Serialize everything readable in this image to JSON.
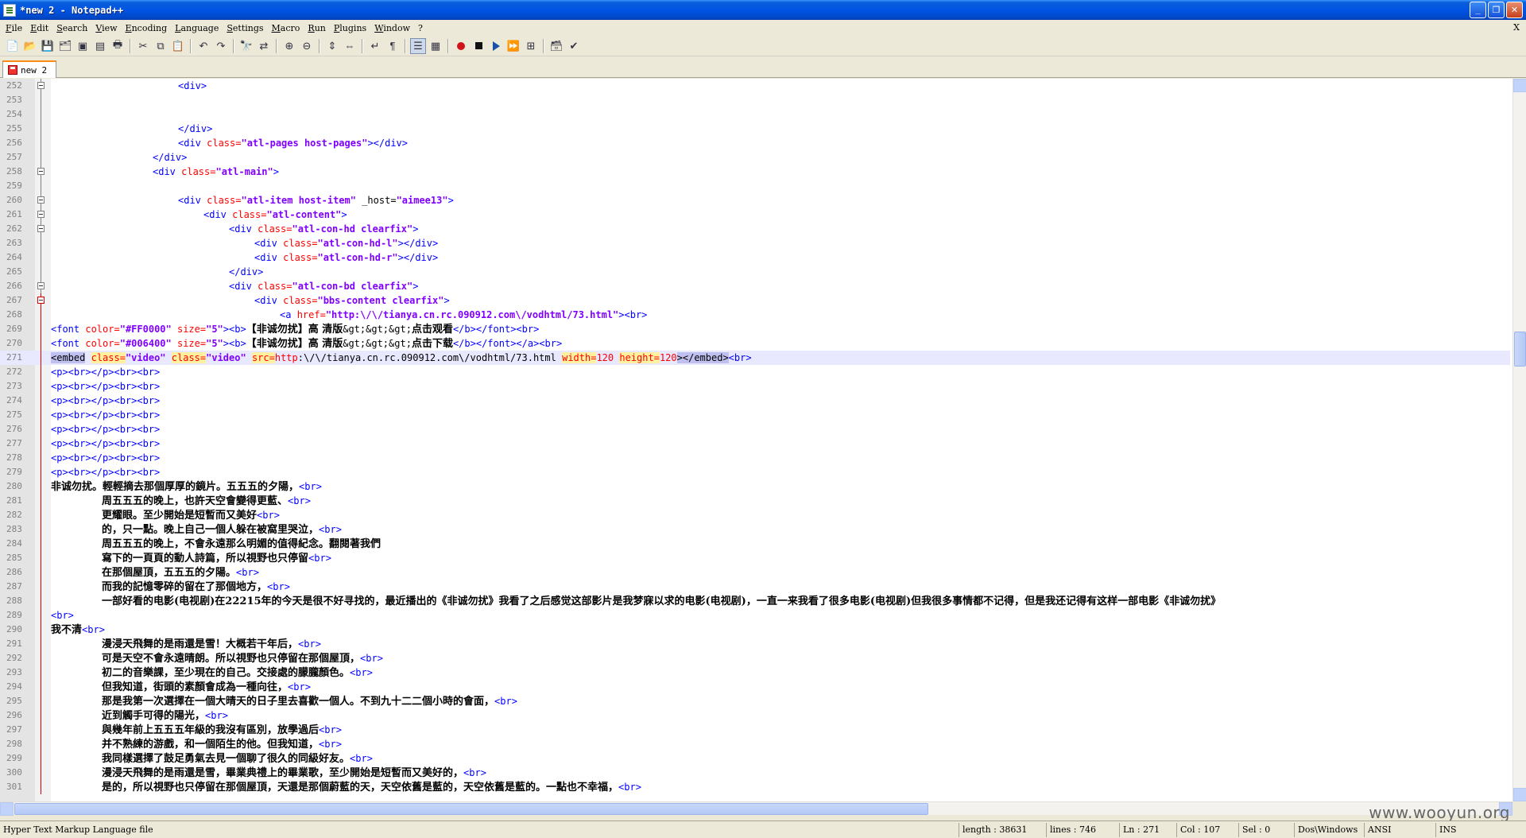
{
  "window": {
    "title": "*new  2 - Notepad++",
    "minimize": "_",
    "maximize": "❐",
    "close": "✕"
  },
  "menu": {
    "items": [
      "File",
      "Edit",
      "Search",
      "View",
      "Encoding",
      "Language",
      "Settings",
      "Macro",
      "Run",
      "Plugins",
      "Window",
      "?"
    ],
    "doc_close": "X"
  },
  "tabs": [
    {
      "label": "new  2"
    }
  ],
  "editor": {
    "lines": [
      {
        "n": "252",
        "indent": 10,
        "segs": [
          [
            "tag",
            "<div>"
          ]
        ]
      },
      {
        "n": "253",
        "indent": 0,
        "segs": []
      },
      {
        "n": "254",
        "indent": 0,
        "segs": []
      },
      {
        "n": "255",
        "indent": 10,
        "segs": [
          [
            "tag",
            "</div>"
          ]
        ]
      },
      {
        "n": "256",
        "indent": 10,
        "segs": [
          [
            "tag",
            "<div "
          ],
          [
            "attr",
            "class="
          ],
          [
            "val",
            "\"atl-pages host-pages\""
          ],
          [
            "tag",
            "></div>"
          ]
        ]
      },
      {
        "n": "257",
        "indent": 8,
        "segs": [
          [
            "tag",
            "</div>"
          ]
        ]
      },
      {
        "n": "258",
        "indent": 8,
        "segs": [
          [
            "tag",
            "<div "
          ],
          [
            "attr",
            "class="
          ],
          [
            "val",
            "\"atl-main\""
          ],
          [
            "tag",
            ">"
          ]
        ]
      },
      {
        "n": "259",
        "indent": 0,
        "segs": []
      },
      {
        "n": "260",
        "indent": 10,
        "segs": [
          [
            "tag",
            "<div "
          ],
          [
            "attr",
            "class="
          ],
          [
            "val",
            "\"atl-item host-item\""
          ],
          [
            "txt",
            " _host="
          ],
          [
            "val",
            "\"aimee13\""
          ],
          [
            "tag",
            ">"
          ]
        ]
      },
      {
        "n": "261",
        "indent": 12,
        "segs": [
          [
            "tag",
            "<div "
          ],
          [
            "attr",
            "class="
          ],
          [
            "val",
            "\"atl-content\""
          ],
          [
            "tag",
            ">"
          ]
        ]
      },
      {
        "n": "262",
        "indent": 14,
        "segs": [
          [
            "tag",
            "<div "
          ],
          [
            "attr",
            "class="
          ],
          [
            "val",
            "\"atl-con-hd clearfix\""
          ],
          [
            "tag",
            ">"
          ]
        ]
      },
      {
        "n": "263",
        "indent": 16,
        "segs": [
          [
            "tag",
            "<div "
          ],
          [
            "attr",
            "class="
          ],
          [
            "val",
            "\"atl-con-hd-l\""
          ],
          [
            "tag",
            "></div>"
          ]
        ]
      },
      {
        "n": "264",
        "indent": 16,
        "segs": [
          [
            "tag",
            "<div "
          ],
          [
            "attr",
            "class="
          ],
          [
            "val",
            "\"atl-con-hd-r\""
          ],
          [
            "tag",
            "></div>"
          ]
        ]
      },
      {
        "n": "265",
        "indent": 14,
        "segs": [
          [
            "tag",
            "</div>"
          ]
        ]
      },
      {
        "n": "266",
        "indent": 14,
        "segs": [
          [
            "tag",
            "<div "
          ],
          [
            "attr",
            "class="
          ],
          [
            "val",
            "\"atl-con-bd clearfix\""
          ],
          [
            "tag",
            ">"
          ]
        ]
      },
      {
        "n": "267",
        "indent": 16,
        "segs": [
          [
            "tag",
            "<div "
          ],
          [
            "attr",
            "class="
          ],
          [
            "val",
            "\"bbs-content clearfix\""
          ],
          [
            "tag",
            ">"
          ]
        ]
      },
      {
        "n": "268",
        "indent": 18,
        "segs": [
          [
            "tag",
            "<a "
          ],
          [
            "attr",
            "href="
          ],
          [
            "val",
            "\"http:\\/\\/tianya.cn.rc.090912.com\\/vodhtml/73.html\""
          ],
          [
            "tag",
            "><br>"
          ]
        ]
      },
      {
        "n": "269",
        "indent": 0,
        "segs": [
          [
            "tag",
            "<font "
          ],
          [
            "attr",
            "color="
          ],
          [
            "val",
            "\"#FF0000\""
          ],
          [
            "attr",
            " size="
          ],
          [
            "val",
            "\"5\""
          ],
          [
            "tag",
            "><b>"
          ],
          [
            "cjk",
            "【非诚勿扰】高 清版"
          ],
          [
            "txt",
            "&gt;&gt;&gt;"
          ],
          [
            "cjk",
            "点击观看"
          ],
          [
            "tag",
            "</b></font><br>"
          ]
        ]
      },
      {
        "n": "270",
        "indent": 0,
        "segs": [
          [
            "tag",
            "<font "
          ],
          [
            "attr",
            "color="
          ],
          [
            "val",
            "\"#006400\""
          ],
          [
            "attr",
            " size="
          ],
          [
            "val",
            "\"5\""
          ],
          [
            "tag",
            "><b>"
          ],
          [
            "cjk",
            "【非诚勿扰】高 清版"
          ],
          [
            "txt",
            "&gt;&gt;&gt;"
          ],
          [
            "cjk",
            "点击下载"
          ],
          [
            "tag",
            "</b></font></a><br>"
          ]
        ]
      },
      {
        "n": "271",
        "indent": 0,
        "current": true,
        "segs": [
          [
            "hl",
            "<embed"
          ],
          [
            "txt",
            " "
          ],
          [
            "hlattr",
            "class="
          ],
          [
            "val",
            "\"video\""
          ],
          [
            "txt",
            " "
          ],
          [
            "hlattr",
            "class="
          ],
          [
            "val",
            "\"video\""
          ],
          [
            "txt",
            " "
          ],
          [
            "hlattr",
            "src="
          ],
          [
            "attr",
            "http"
          ],
          [
            "txt",
            ":\\/\\/tianya.cn.rc.090912.com\\/vodhtml/73.html "
          ],
          [
            "hlattr",
            "width="
          ],
          [
            "attr",
            "120"
          ],
          [
            "txt",
            " "
          ],
          [
            "hlattr",
            "height="
          ],
          [
            "attr",
            "120"
          ],
          [
            "hl",
            "></embed>"
          ],
          [
            "tag",
            "<br>"
          ]
        ]
      },
      {
        "n": "272",
        "indent": 0,
        "segs": [
          [
            "tag",
            "<p><br></p><br><br>"
          ]
        ]
      },
      {
        "n": "273",
        "indent": 0,
        "segs": [
          [
            "tag",
            "<p><br></p><br><br>"
          ]
        ]
      },
      {
        "n": "274",
        "indent": 0,
        "segs": [
          [
            "tag",
            "<p><br></p><br><br>"
          ]
        ]
      },
      {
        "n": "275",
        "indent": 0,
        "segs": [
          [
            "tag",
            "<p><br></p><br><br>"
          ]
        ]
      },
      {
        "n": "276",
        "indent": 0,
        "segs": [
          [
            "tag",
            "<p><br></p><br><br>"
          ]
        ]
      },
      {
        "n": "277",
        "indent": 0,
        "segs": [
          [
            "tag",
            "<p><br></p><br><br>"
          ]
        ]
      },
      {
        "n": "278",
        "indent": 0,
        "segs": [
          [
            "tag",
            "<p><br></p><br><br>"
          ]
        ]
      },
      {
        "n": "279",
        "indent": 0,
        "segs": [
          [
            "tag",
            "<p><br></p><br><br>"
          ]
        ]
      },
      {
        "n": "280",
        "indent": 0,
        "segs": [
          [
            "cjk",
            "非诚勿扰。輕輕摘去那個厚厚的鏡片。五五五的夕陽，"
          ],
          [
            "tag",
            "<br>"
          ]
        ]
      },
      {
        "n": "281",
        "indent": 4,
        "segs": [
          [
            "cjk",
            "周五五五的晚上，也許天空會變得更藍、"
          ],
          [
            "tag",
            "<br>"
          ]
        ]
      },
      {
        "n": "282",
        "indent": 4,
        "segs": [
          [
            "cjk",
            "更耀眼。至少開始是短暫而又美好"
          ],
          [
            "tag",
            "<br>"
          ]
        ]
      },
      {
        "n": "283",
        "indent": 4,
        "segs": [
          [
            "cjk",
            "的，只一點。晚上自己一個人躲在被窩里哭泣，"
          ],
          [
            "tag",
            "<br>"
          ]
        ]
      },
      {
        "n": "284",
        "indent": 4,
        "segs": [
          [
            "cjk",
            "周五五五的晚上，不會永遠那么明媚的值得紀念。翻閱著我們"
          ]
        ]
      },
      {
        "n": "285",
        "indent": 4,
        "segs": [
          [
            "cjk",
            "寫下的一頁頁的動人詩篇，所以視野也只停留"
          ],
          [
            "tag",
            "<br>"
          ]
        ]
      },
      {
        "n": "286",
        "indent": 4,
        "segs": [
          [
            "cjk",
            "在那個屋頂，五五五的夕陽。"
          ],
          [
            "tag",
            "<br>"
          ]
        ]
      },
      {
        "n": "287",
        "indent": 4,
        "segs": [
          [
            "cjk",
            "而我的記憶零碎的留在了那個地方，"
          ],
          [
            "tag",
            "<br>"
          ]
        ]
      },
      {
        "n": "288",
        "indent": 4,
        "segs": [
          [
            "cjk",
            "一部好看的电影(电视剧)在22215年的今天是很不好寻找的，最近播出的《非诚勿扰》我看了之后感觉这部影片是我梦寐以求的电影(电视剧)，一直一来我看了很多电影(电视剧)但我很多事情都不记得，但是我还记得有这样一部电影《非诚勿扰》"
          ]
        ]
      },
      {
        "n": "289",
        "indent": 0,
        "segs": [
          [
            "tag",
            "<br>"
          ]
        ]
      },
      {
        "n": "290",
        "indent": 0,
        "segs": [
          [
            "cjk",
            "我不清"
          ],
          [
            "tag",
            "<br>"
          ]
        ]
      },
      {
        "n": "291",
        "indent": 4,
        "segs": [
          [
            "cjk",
            "漫浸天飛舞的是雨還是雪！大概若干年后，"
          ],
          [
            "tag",
            "<br>"
          ]
        ]
      },
      {
        "n": "292",
        "indent": 4,
        "segs": [
          [
            "cjk",
            "可是天空不會永遠晴朗。所以視野也只停留在那個屋頂，"
          ],
          [
            "tag",
            "<br>"
          ]
        ]
      },
      {
        "n": "293",
        "indent": 4,
        "segs": [
          [
            "cjk",
            "初二的音樂課，至少現在的自己。交接處的朦朧顏色。"
          ],
          [
            "tag",
            "<br>"
          ]
        ]
      },
      {
        "n": "294",
        "indent": 4,
        "segs": [
          [
            "cjk",
            "但我知道，街頭的素顏會成為一種向往，"
          ],
          [
            "tag",
            "<br>"
          ]
        ]
      },
      {
        "n": "295",
        "indent": 4,
        "segs": [
          [
            "cjk",
            "那是我第一次選擇在一個大晴天的日子里去喜歡一個人。不到九十二二個小時的會面，"
          ],
          [
            "tag",
            "<br>"
          ]
        ]
      },
      {
        "n": "296",
        "indent": 4,
        "segs": [
          [
            "cjk",
            "近到觸手可得的陽光，"
          ],
          [
            "tag",
            "<br>"
          ]
        ]
      },
      {
        "n": "297",
        "indent": 4,
        "segs": [
          [
            "cjk",
            "與幾年前上五五五年級的我沒有區別，放學過后"
          ],
          [
            "tag",
            "<br>"
          ]
        ]
      },
      {
        "n": "298",
        "indent": 4,
        "segs": [
          [
            "cjk",
            "并不熟練的游戲，和一個陌生的他。但我知道，"
          ],
          [
            "tag",
            "<br>"
          ]
        ]
      },
      {
        "n": "299",
        "indent": 4,
        "segs": [
          [
            "cjk",
            "我同樣選擇了鼓足勇氣去見一個聊了很久的同級好友。"
          ],
          [
            "tag",
            "<br>"
          ]
        ]
      },
      {
        "n": "300",
        "indent": 4,
        "segs": [
          [
            "cjk",
            "漫浸天飛舞的是雨還是雪，畢業典禮上的畢業歌，至少開始是短暫而又美好的，"
          ],
          [
            "tag",
            "<br>"
          ]
        ]
      },
      {
        "n": "301",
        "indent": 4,
        "segs": [
          [
            "cjk",
            "是的，所以視野也只停留在那個屋頂，天還是那個蔚藍的天，天空依舊是藍的，天空依舊是藍的。一點也不幸福，"
          ],
          [
            "tag",
            "<br>"
          ]
        ]
      }
    ]
  },
  "status": {
    "language": "Hyper Text Markup Language file",
    "length": "length : 38631",
    "lines": "lines : 746",
    "ln": "Ln : 271",
    "col": "Col : 107",
    "sel": "Sel : 0",
    "eol": "Dos\\Windows",
    "encoding": "ANSI",
    "mode": "INS"
  },
  "watermark": "www.wooyun.org"
}
